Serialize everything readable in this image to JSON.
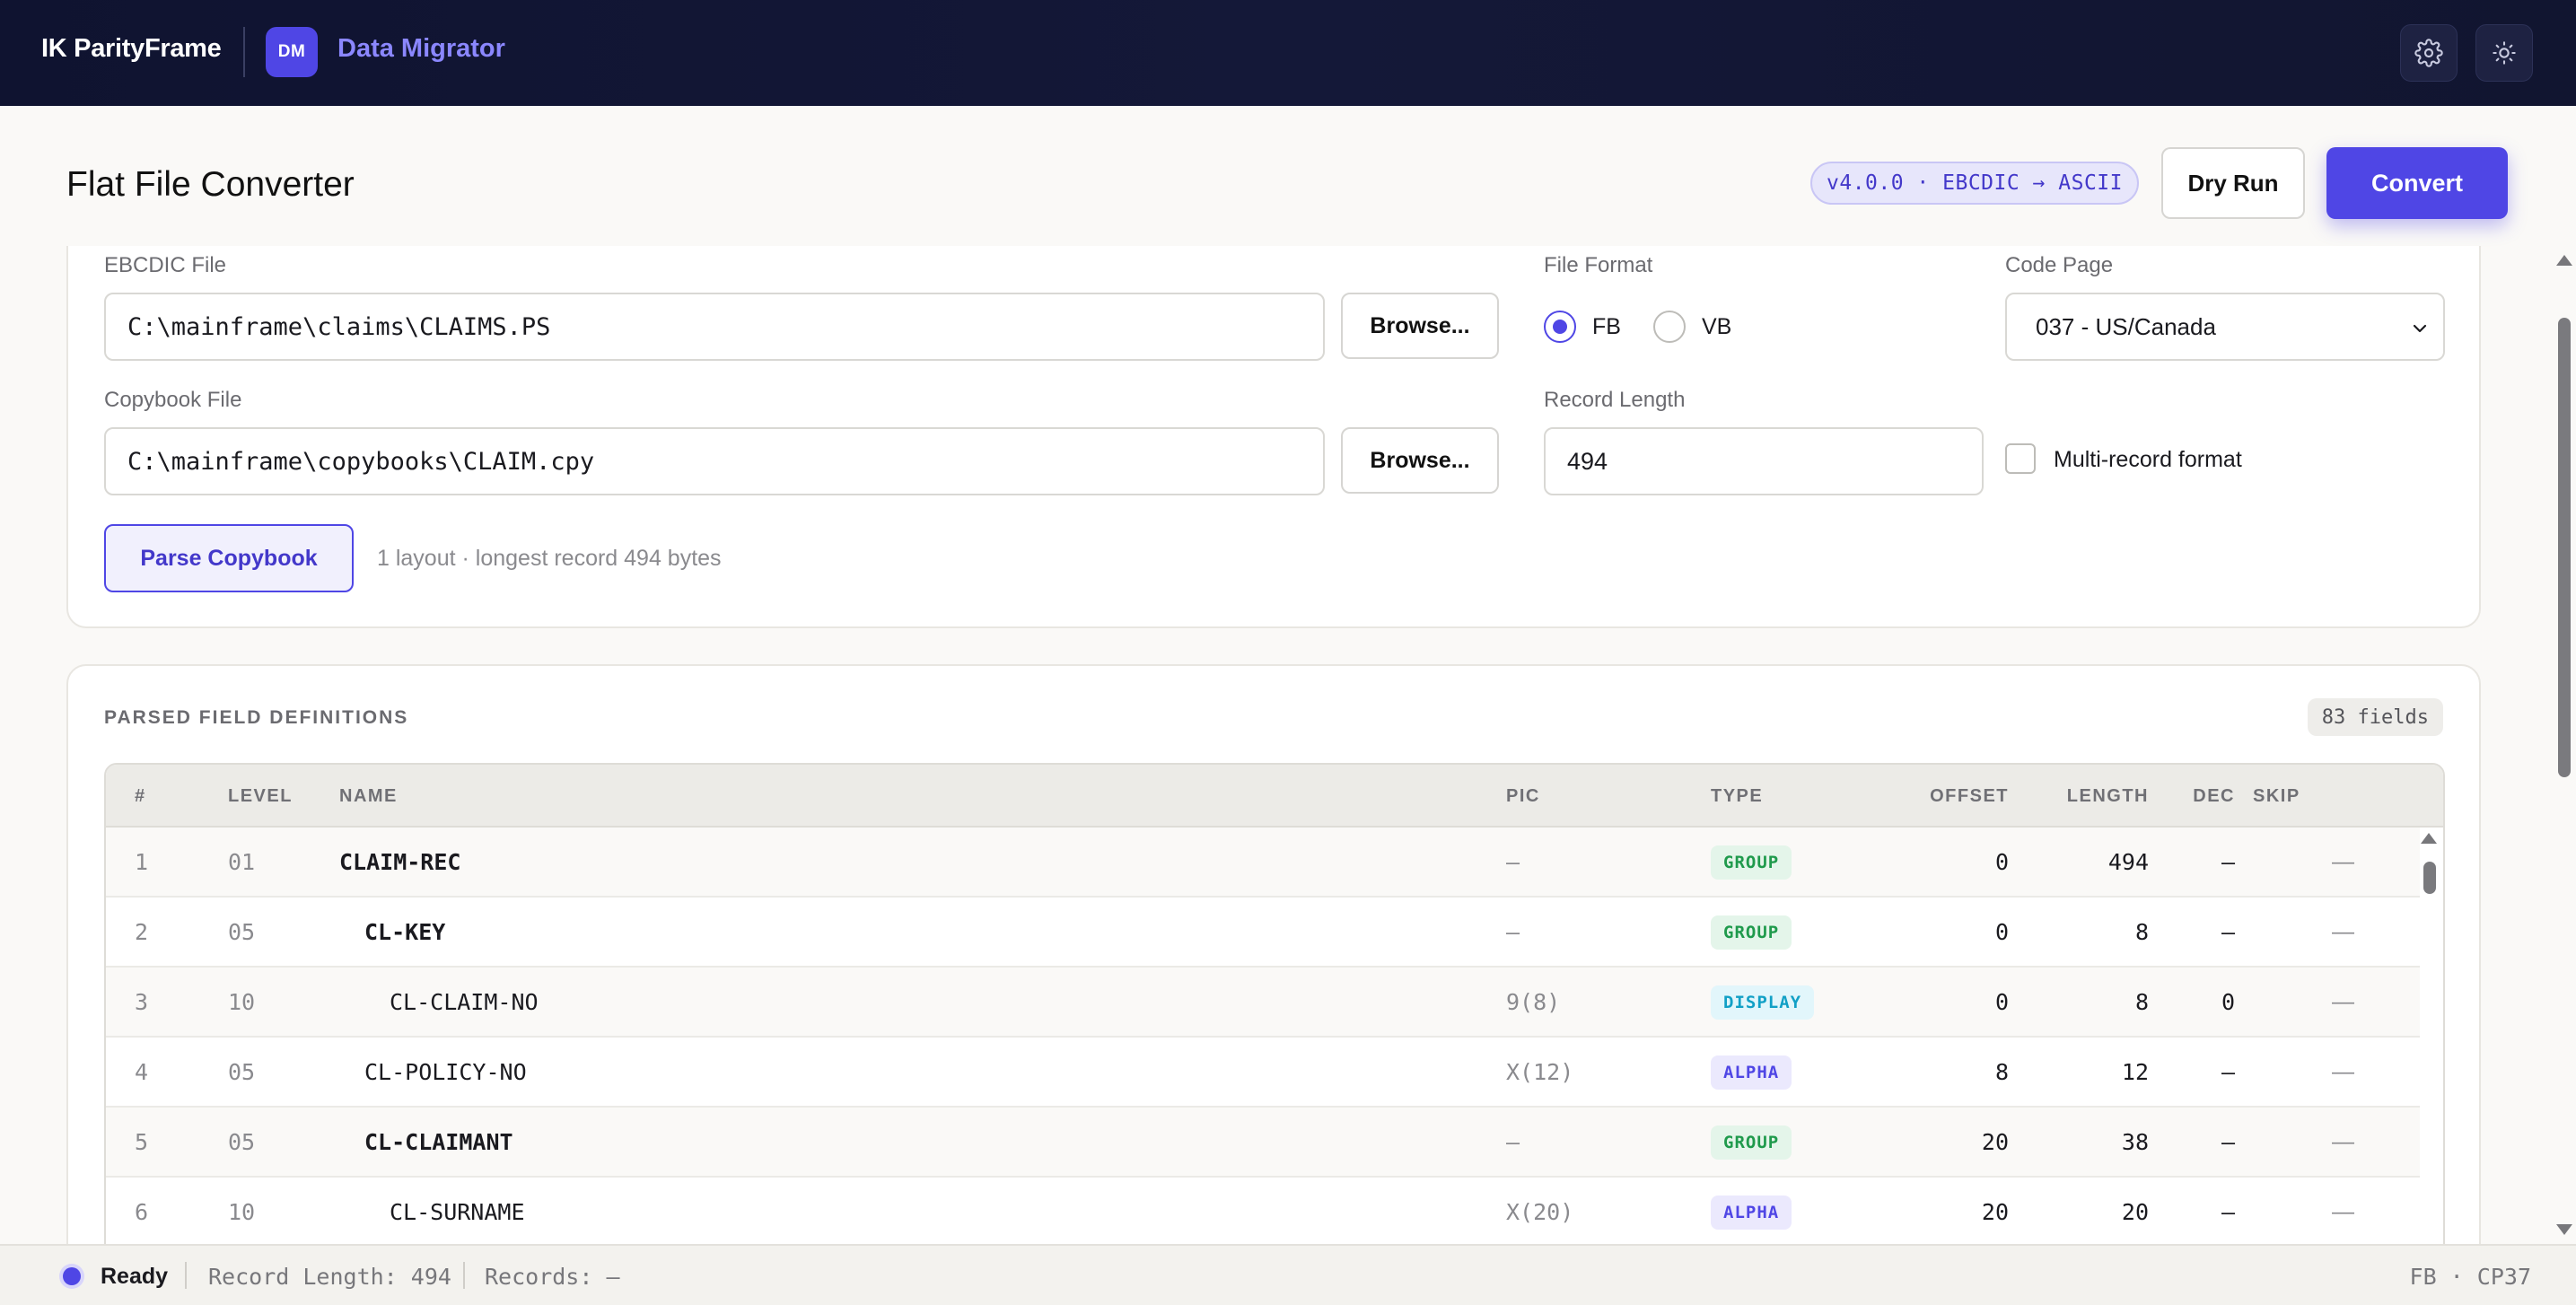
{
  "nav": {
    "brand": "IK ParityFrame",
    "badge": "DM",
    "app_name": "Data Migrator"
  },
  "header": {
    "title": "Flat File Converter",
    "version": "v4.0.0 · EBCDIC → ASCII",
    "dry_run_label": "Dry Run",
    "convert_label": "Convert"
  },
  "form": {
    "ebcdic_label": "EBCDIC File",
    "ebcdic_value": "C:\\mainframe\\claims\\CLAIMS.PS",
    "copybook_label": "Copybook File",
    "copybook_value": "C:\\mainframe\\copybooks\\CLAIM.cpy",
    "browse_label": "Browse...",
    "file_format_label": "File Format",
    "format_options": [
      "FB",
      "VB"
    ],
    "format_selected": "FB",
    "code_page_label": "Code Page",
    "code_page_value": "037 - US/Canada",
    "record_length_label": "Record Length",
    "record_length_value": "494",
    "multi_record_label": "Multi-record format",
    "multi_record_checked": false,
    "parse_label": "Parse Copybook",
    "parse_hint": "1 layout · longest record 494 bytes"
  },
  "fields": {
    "title": "PARSED FIELD DEFINITIONS",
    "count": "83 fields",
    "columns": [
      "#",
      "LEVEL",
      "NAME",
      "PIC",
      "TYPE",
      "OFFSET",
      "LENGTH",
      "DEC",
      "SKIP"
    ],
    "rows": [
      {
        "num": "1",
        "level": "01",
        "name": "CLAIM-REC",
        "pic": "—",
        "type": "GROUP",
        "offset": "0",
        "length": "494",
        "dec": "—",
        "skip": "—"
      },
      {
        "num": "2",
        "level": "05",
        "name": "CL-KEY",
        "pic": "—",
        "type": "GROUP",
        "offset": "0",
        "length": "8",
        "dec": "—",
        "skip": "—"
      },
      {
        "num": "3",
        "level": "10",
        "name": "CL-CLAIM-NO",
        "pic": "9(8)",
        "type": "DISPLAY",
        "offset": "0",
        "length": "8",
        "dec": "0",
        "skip": "—"
      },
      {
        "num": "4",
        "level": "05",
        "name": "CL-POLICY-NO",
        "pic": "X(12)",
        "type": "ALPHA",
        "offset": "8",
        "length": "12",
        "dec": "—",
        "skip": "—"
      },
      {
        "num": "5",
        "level": "05",
        "name": "CL-CLAIMANT",
        "pic": "—",
        "type": "GROUP",
        "offset": "20",
        "length": "38",
        "dec": "—",
        "skip": "—"
      },
      {
        "num": "6",
        "level": "10",
        "name": "CL-SURNAME",
        "pic": "X(20)",
        "type": "ALPHA",
        "offset": "20",
        "length": "20",
        "dec": "—",
        "skip": "—"
      }
    ]
  },
  "status": {
    "state": "Ready",
    "record_length": "Record Length: 494",
    "records": "Records: —",
    "right": "FB · CP37"
  },
  "colors": {
    "accent": "#4f46e5",
    "nav_bg": "#0f1330",
    "group": "#1f9a4c",
    "display": "#12a0c6",
    "alpha": "#4f46e5"
  }
}
